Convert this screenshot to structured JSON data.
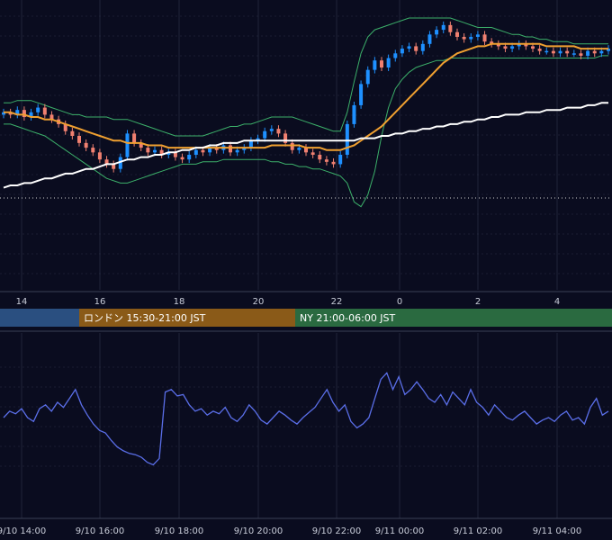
{
  "colors": {
    "background": "#0a0c1f",
    "grid": "#2a2f45",
    "candle_up": "#1e90ff",
    "candle_down": "#f08070",
    "bollinger": "#3cb06a",
    "ma_short": "#f0a030",
    "ma_long": "#ffffff",
    "oscillator": "#5a6ee8",
    "session_tokyo": "#2a4f80",
    "session_london": "#8a5a18",
    "session_ny": "#2a6a40"
  },
  "sessions": [
    {
      "label": "",
      "color_key": "session_tokyo"
    },
    {
      "label": "ロンドン 15:30-21:00 JST",
      "color_key": "session_london"
    },
    {
      "label": "NY 21:00-06:00 JST",
      "color_key": "session_ny"
    }
  ],
  "chart_data": [
    {
      "type": "candlestick",
      "x_axis": {
        "type": "hour",
        "ticks": [
          "14",
          "16",
          "18",
          "20",
          "22",
          "0",
          "2",
          "4"
        ]
      },
      "y_axis": {
        "labels_visible": false,
        "ylim": [
          0,
          100
        ]
      },
      "grid": true,
      "series": [
        {
          "kind": "candles",
          "values_close": [
            60,
            59,
            61,
            58,
            60,
            62,
            59,
            57,
            55,
            52,
            50,
            47,
            45,
            43,
            40,
            38,
            36,
            41,
            51,
            47,
            45,
            43,
            44,
            42,
            43,
            41,
            40,
            42,
            44,
            43,
            45,
            44,
            46,
            43,
            44,
            45,
            48,
            49,
            52,
            53,
            51,
            47,
            44,
            45,
            43,
            42,
            40,
            39,
            38,
            42,
            55,
            63,
            72,
            78,
            82,
            79,
            83,
            85,
            87,
            88,
            86,
            89,
            93,
            95,
            97,
            94,
            92,
            91,
            92,
            93,
            90,
            89,
            88,
            87,
            88,
            89,
            88,
            87,
            86,
            86,
            85,
            86,
            85,
            85,
            84,
            86,
            85,
            86,
            87
          ],
          "values_open": [
            59,
            60,
            59,
            61,
            58,
            60,
            62,
            59,
            57,
            55,
            52,
            50,
            47,
            45,
            43,
            40,
            38,
            36,
            41,
            51,
            47,
            45,
            43,
            44,
            42,
            43,
            41,
            40,
            42,
            44,
            43,
            45,
            44,
            46,
            43,
            44,
            45,
            48,
            49,
            52,
            53,
            51,
            47,
            44,
            45,
            43,
            42,
            40,
            39,
            38,
            42,
            55,
            63,
            72,
            78,
            82,
            79,
            83,
            85,
            87,
            88,
            86,
            89,
            93,
            95,
            97,
            94,
            92,
            91,
            92,
            93,
            90,
            89,
            88,
            87,
            88,
            89,
            88,
            87,
            86,
            86,
            85,
            86,
            85,
            85,
            84,
            86,
            85,
            86
          ]
        },
        {
          "kind": "bollinger_upper",
          "values": [
            64,
            64,
            65,
            65,
            65,
            64,
            63,
            62,
            61,
            60,
            59,
            59,
            58,
            58,
            58,
            58,
            57,
            57,
            57,
            56,
            55,
            54,
            53,
            52,
            51,
            50,
            50,
            50,
            50,
            50,
            51,
            52,
            53,
            54,
            54,
            55,
            55,
            56,
            57,
            58,
            58,
            58,
            58,
            57,
            56,
            55,
            54,
            53,
            52,
            52,
            60,
            73,
            85,
            92,
            95,
            96,
            97,
            98,
            99,
            100,
            100,
            100,
            100,
            100,
            100,
            100,
            99,
            98,
            97,
            96,
            96,
            96,
            95,
            94,
            93,
            93,
            92,
            92,
            91,
            91,
            90,
            90,
            90,
            89,
            89,
            89,
            89,
            89,
            89
          ]
        },
        {
          "kind": "bollinger_lower",
          "values": [
            55,
            55,
            54,
            53,
            52,
            51,
            50,
            48,
            46,
            44,
            42,
            40,
            38,
            36,
            34,
            32,
            31,
            30,
            30,
            31,
            32,
            33,
            34,
            35,
            36,
            37,
            38,
            38,
            38,
            39,
            39,
            39,
            40,
            40,
            40,
            40,
            40,
            40,
            40,
            39,
            39,
            38,
            38,
            37,
            37,
            36,
            36,
            35,
            34,
            33,
            30,
            22,
            20,
            25,
            35,
            50,
            62,
            70,
            74,
            77,
            79,
            80,
            81,
            82,
            82,
            83,
            83,
            83,
            83,
            83,
            83,
            83,
            83,
            83,
            83,
            83,
            83,
            83,
            83,
            83,
            83,
            83,
            83,
            83,
            83,
            83,
            83,
            84,
            84
          ]
        },
        {
          "kind": "ma_short",
          "values": [
            60,
            60,
            59,
            59,
            58,
            58,
            57,
            57,
            56,
            55,
            54,
            53,
            52,
            51,
            50,
            49,
            48,
            48,
            47,
            47,
            47,
            46,
            46,
            46,
            45,
            45,
            45,
            45,
            45,
            45,
            45,
            45,
            45,
            45,
            45,
            45,
            45,
            45,
            45,
            46,
            46,
            46,
            46,
            46,
            45,
            45,
            45,
            44,
            44,
            44,
            45,
            46,
            48,
            50,
            52,
            54,
            57,
            60,
            63,
            66,
            69,
            72,
            75,
            78,
            81,
            83,
            85,
            86,
            87,
            88,
            88,
            89,
            89,
            89,
            89,
            89,
            89,
            89,
            89,
            88,
            88,
            88,
            88,
            88,
            87,
            87,
            87,
            87,
            87
          ]
        },
        {
          "kind": "ma_long",
          "values": [
            28,
            29,
            29,
            30,
            30,
            31,
            32,
            32,
            33,
            34,
            34,
            35,
            36,
            36,
            37,
            38,
            38,
            39,
            40,
            40,
            41,
            41,
            42,
            42,
            43,
            43,
            44,
            44,
            45,
            45,
            46,
            46,
            47,
            47,
            47,
            48,
            48,
            48,
            48,
            48,
            48,
            48,
            48,
            48,
            48,
            48,
            48,
            48,
            48,
            48,
            48,
            48,
            49,
            49,
            49,
            50,
            50,
            51,
            51,
            52,
            52,
            53,
            53,
            54,
            54,
            55,
            55,
            56,
            56,
            57,
            57,
            58,
            58,
            59,
            59,
            59,
            60,
            60,
            60,
            61,
            61,
            61,
            62,
            62,
            62,
            63,
            63,
            64,
            64
          ]
        }
      ]
    },
    {
      "type": "line",
      "x_axis": {
        "ticks": [
          "9/10 14:00",
          "9/10 16:00",
          "9/10 18:00",
          "9/10 20:00",
          "9/10 22:00",
          "9/11 00:00",
          "9/11 02:00",
          "9/11 04:00"
        ]
      },
      "y_axis": {
        "labels_visible": false,
        "ylim": [
          0,
          100
        ]
      },
      "grid": true,
      "series": [
        {
          "values": [
            50,
            55,
            53,
            57,
            50,
            47,
            57,
            60,
            55,
            62,
            58,
            65,
            72,
            60,
            52,
            45,
            40,
            38,
            32,
            27,
            24,
            22,
            21,
            19,
            15,
            13,
            18,
            70,
            72,
            67,
            68,
            60,
            55,
            57,
            52,
            55,
            53,
            58,
            50,
            47,
            52,
            60,
            55,
            48,
            45,
            50,
            55,
            52,
            48,
            45,
            50,
            54,
            58,
            65,
            72,
            62,
            55,
            60,
            47,
            42,
            45,
            50,
            65,
            80,
            85,
            72,
            82,
            68,
            72,
            78,
            72,
            65,
            62,
            68,
            60,
            70,
            65,
            60,
            72,
            62,
            58,
            52,
            60,
            55,
            50,
            48,
            52,
            55,
            50,
            45,
            48,
            50,
            47,
            52,
            55,
            48,
            50,
            45,
            58,
            65,
            52,
            55
          ]
        }
      ]
    }
  ]
}
